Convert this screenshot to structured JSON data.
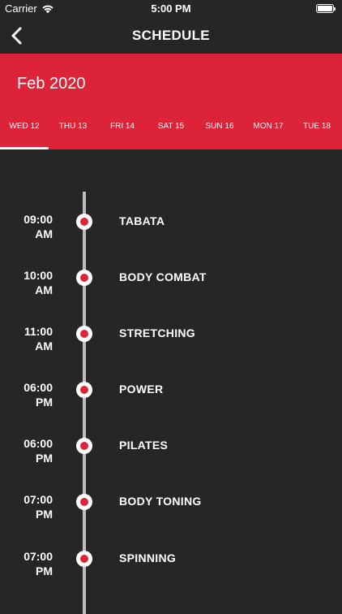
{
  "status_bar": {
    "carrier": "Carrier",
    "time": "5:00 PM"
  },
  "nav": {
    "title": "SCHEDULE"
  },
  "header": {
    "month": "Feb 2020"
  },
  "days": [
    "WED 12",
    "THU 13",
    "FRI 14",
    "SAT 15",
    "SUN 16",
    "MON 17",
    "TUE 18"
  ],
  "selected_day": "WED 12",
  "schedule": [
    {
      "time": "09:00",
      "ampm": "AM",
      "name": "TABATA"
    },
    {
      "time": "10:00",
      "ampm": "AM",
      "name": "BODY COMBAT"
    },
    {
      "time": "11:00",
      "ampm": "AM",
      "name": "STRETCHING"
    },
    {
      "time": "06:00",
      "ampm": "PM",
      "name": "POWER"
    },
    {
      "time": "06:00",
      "ampm": "PM",
      "name": "PILATES"
    },
    {
      "time": "07:00",
      "ampm": "PM",
      "name": "BODY TONING"
    },
    {
      "time": "07:00",
      "ampm": "PM",
      "name": "SPINNING"
    }
  ],
  "colors": {
    "accent": "#dc2338",
    "background": "#262626"
  }
}
